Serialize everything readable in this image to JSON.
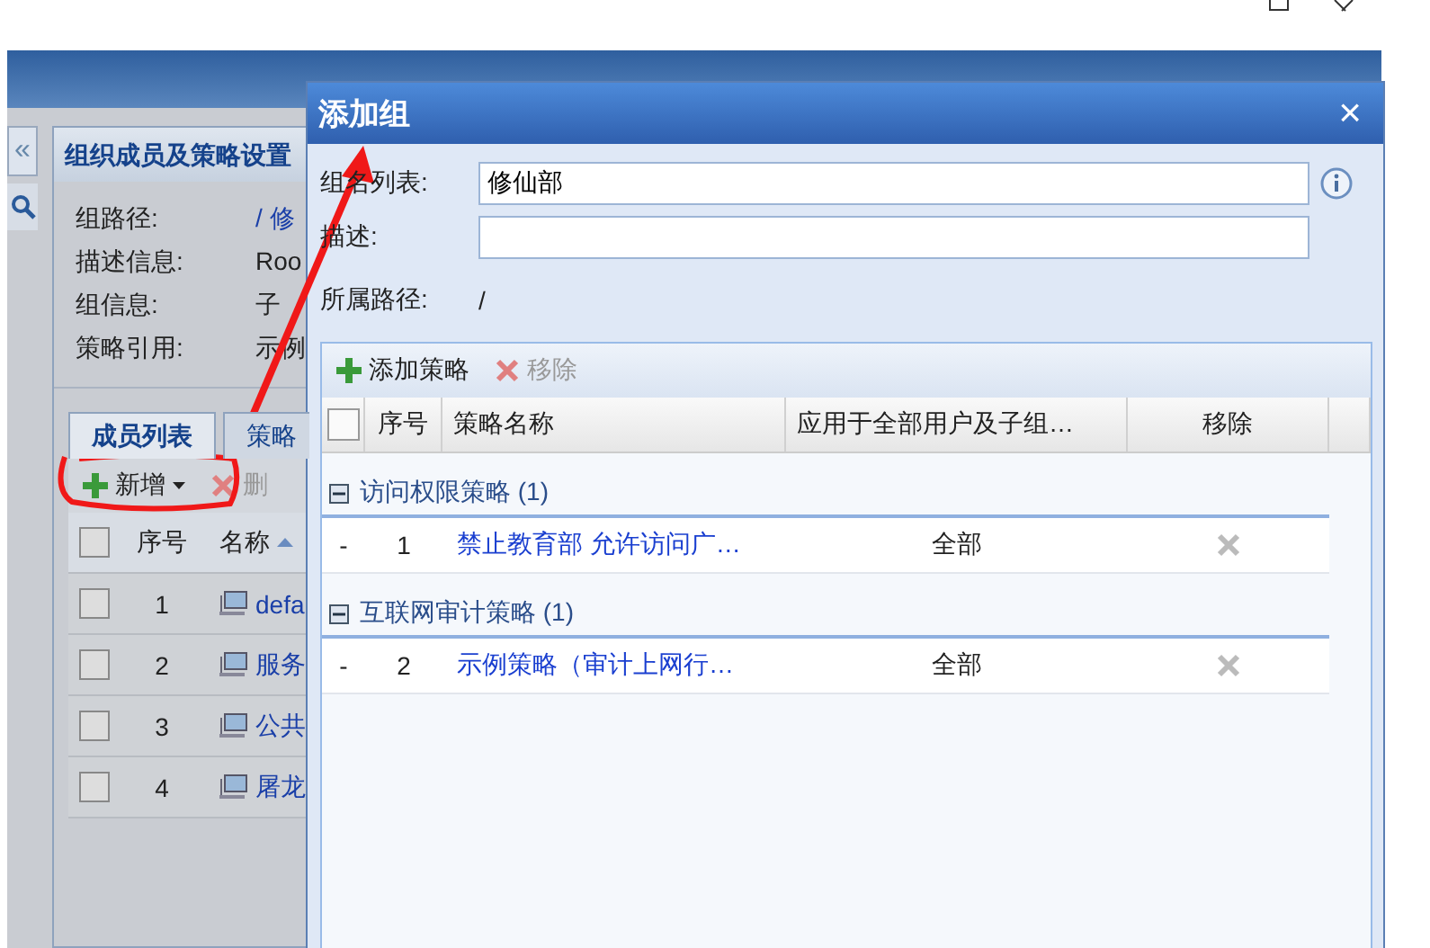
{
  "app": {
    "collapse_label": "«",
    "panel_title": "组织成员及策略设置",
    "info": [
      {
        "label": "组路径:",
        "value": "/ 修"
      },
      {
        "label": "描述信息:",
        "value": "Roo"
      },
      {
        "label": "组信息:",
        "value": "子"
      },
      {
        "label": "策略引用:",
        "value": "示例"
      }
    ],
    "tabs": [
      {
        "label": "成员列表",
        "selected": true
      },
      {
        "label": "策略",
        "selected": false
      }
    ],
    "toolbar": [
      {
        "kind": "add",
        "label": "新增",
        "disabled": false
      },
      {
        "kind": "delete",
        "label": "删",
        "disabled": true
      }
    ],
    "grid": {
      "select_all": false,
      "columns": [
        "序号",
        "名称"
      ],
      "rows": [
        {
          "index": "1",
          "name": "defa",
          "checked": false
        },
        {
          "index": "2",
          "name": "服务",
          "checked": false
        },
        {
          "index": "3",
          "name": "公共",
          "checked": false
        },
        {
          "index": "4",
          "name": "屠龙",
          "checked": false
        }
      ]
    }
  },
  "dialog": {
    "title": "添加组",
    "close": "×",
    "fields": [
      {
        "label": "组名列表:",
        "value": "修仙部",
        "info": true
      },
      {
        "label": "描述:",
        "info": false
      }
    ],
    "path": {
      "label": "所属路径:",
      "value": "/"
    },
    "toolbar": [
      {
        "kind": "add",
        "label": "添加策略",
        "disabled": false
      },
      {
        "kind": "remove",
        "label": "移除",
        "disabled": true
      }
    ],
    "select_all": false,
    "columns": [
      "序号",
      "策略名称",
      "应用于全部用户及子组…",
      "移除"
    ],
    "groups": [
      {
        "title": "访问权限策略 (1)",
        "expanded": true,
        "rows": [
          {
            "marker": "-",
            "index": "1",
            "name": "禁止教育部 允许访问广…",
            "scope": "全部"
          }
        ]
      },
      {
        "title": "互联网审计策略 (1)",
        "expanded": true,
        "rows": [
          {
            "marker": "-",
            "index": "2",
            "name": "示例策略（审计上网行…",
            "scope": "全部"
          }
        ]
      }
    ]
  }
}
